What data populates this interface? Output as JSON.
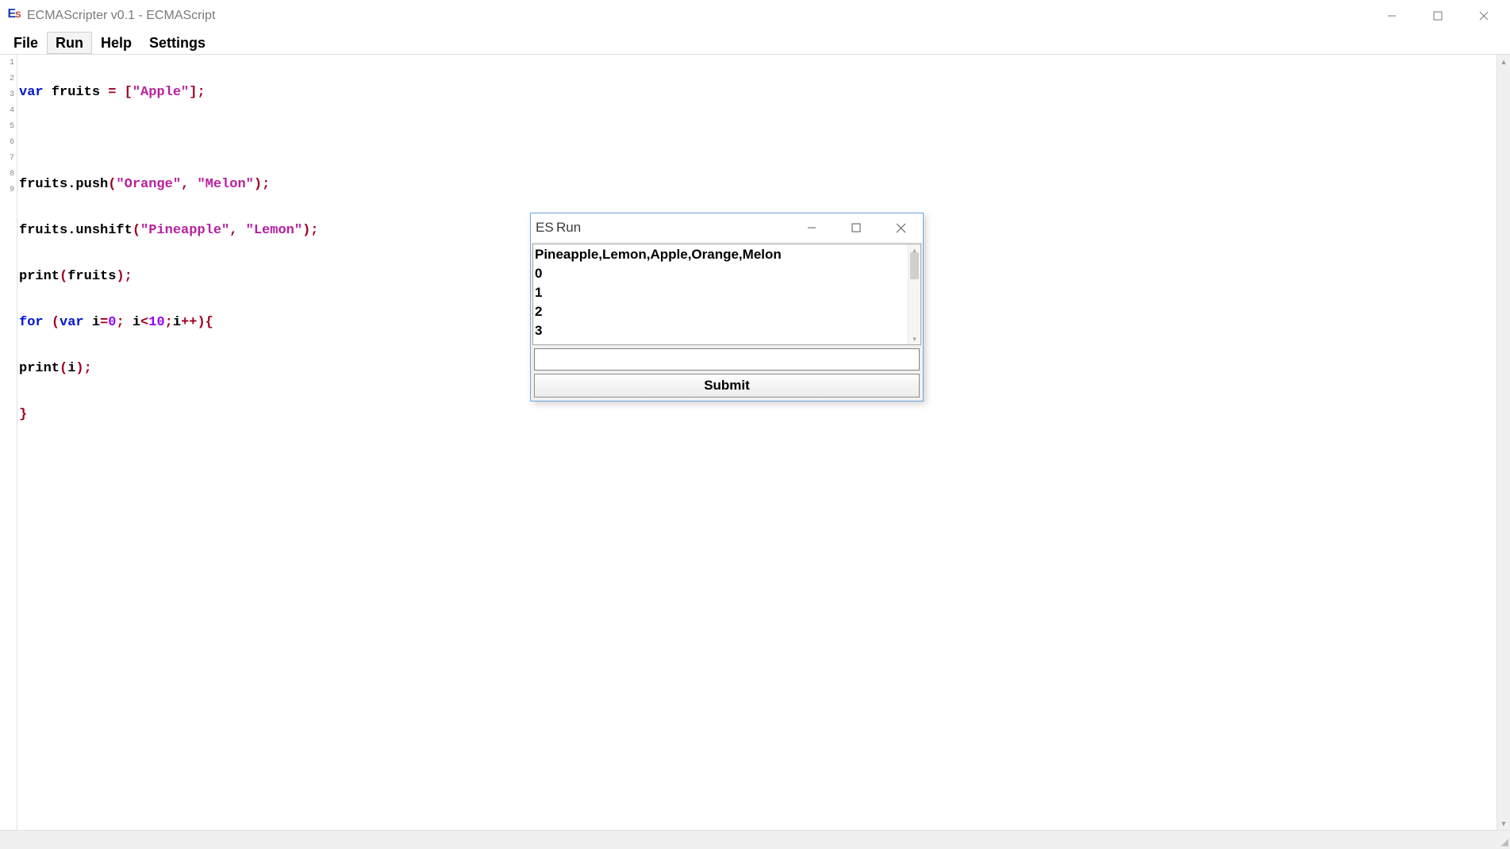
{
  "window": {
    "title": "ECMAScripter v0.1 - ECMAScript",
    "logo_e": "E",
    "logo_s": "S"
  },
  "menu": {
    "file": "File",
    "run": "Run",
    "help": "Help",
    "settings": "Settings"
  },
  "gutter_numbers": [
    "1",
    "2",
    "3",
    "4",
    "5",
    "6",
    "7",
    "8",
    "9"
  ],
  "code": {
    "l1": {
      "kw": "var",
      "sp": " ",
      "id": "fruits ",
      "eq": "= [",
      "s1": "\"Apple\"",
      "end": "];"
    },
    "l3": {
      "id": "fruits.push",
      "op": "(",
      "s1": "\"Orange\"",
      "c1": ", ",
      "s2": "\"Melon\"",
      "cl": ");"
    },
    "l4": {
      "id": "fruits.unshift",
      "op": "(",
      "s1": "\"Pineapple\"",
      "c1": ", ",
      "s2": "\"Lemon\"",
      "cl": ");"
    },
    "l5": {
      "id": "print",
      "op": "(",
      "arg": "fruits",
      "cl": ");"
    },
    "l6": {
      "kw": "for ",
      "op": "(",
      "kw2": "var",
      "sp": " ",
      "id": "i",
      "eq": "=",
      "n0": "0",
      "sc": "; ",
      "id2": "i",
      "lt": "<",
      "n10": "10",
      "sc2": ";",
      "id3": "i",
      "inc": "++",
      "cl": "){"
    },
    "l7": {
      "id": "print",
      "op": "(",
      "arg": "i",
      "cl": ");"
    },
    "l8": {
      "brace": "}"
    }
  },
  "dialog": {
    "title": "Run",
    "output_lines": [
      "Pineapple,Lemon,Apple,Orange,Melon",
      "0",
      "1",
      "2",
      "3"
    ],
    "submit_label": "Submit",
    "input_value": ""
  }
}
